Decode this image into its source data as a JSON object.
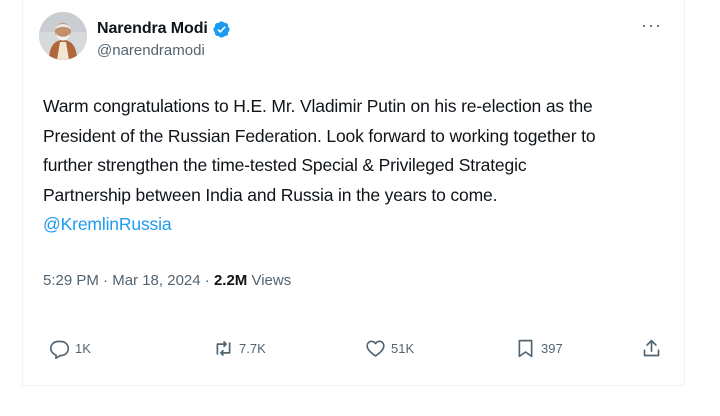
{
  "author": {
    "display_name": "Narendra Modi",
    "handle": "@narendramodi",
    "verified": true
  },
  "more_icon": "more-horizontal-icon",
  "tweet": {
    "lines": [
      "Warm congratulations to H.E. Mr. Vladimir Putin on his re-election as the",
      "President of the Russian Federation. Look forward to working together to",
      "further strengthen the time-tested Special & Privileged Strategic",
      "Partnership between India and Russia in the years to come."
    ],
    "mention": "@KremlinRussia"
  },
  "meta": {
    "time": "5:29 PM",
    "separator": "·",
    "date": "Mar 18, 2024",
    "views_count": "2.2M",
    "views_label": "Views"
  },
  "actions": {
    "reply": {
      "icon": "reply-icon",
      "count": "1K"
    },
    "repost": {
      "icon": "repost-icon",
      "count": "7.7K"
    },
    "like": {
      "icon": "heart-icon",
      "count": "51K"
    },
    "bookmark": {
      "icon": "bookmark-icon",
      "count": "397"
    },
    "share": {
      "icon": "share-icon"
    }
  },
  "colors": {
    "text": "#0f1419",
    "secondary": "#536471",
    "link": "#1d9bf0",
    "verified_badge": "#1d9bf0"
  }
}
